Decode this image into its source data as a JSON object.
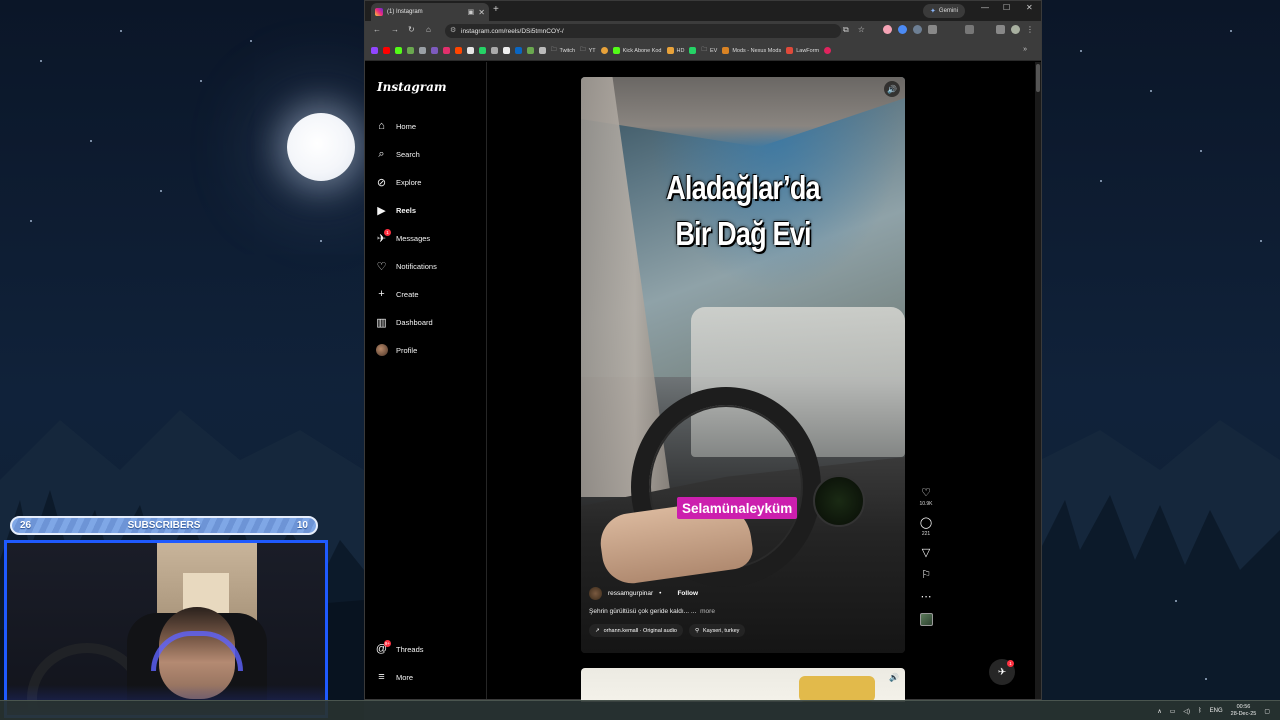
{
  "browser": {
    "tab_title": "(1) Instagram",
    "gemini_label": "Gemini",
    "url": "instagram.com/reels/DSi5tmnCOY-/",
    "bookmarks": [
      {
        "label": "Twitch",
        "color": "#9aa0a6"
      },
      {
        "label": "YT",
        "color": "#9aa0a6"
      },
      {
        "label": "Kick Abone Kod",
        "color": "#53fc18"
      },
      {
        "label": "HD",
        "color": "#e8a23a"
      },
      {
        "label": "EV",
        "color": "#9aa0a6"
      },
      {
        "label": "Mods - Nexus Mods",
        "color": "#d98324"
      },
      {
        "label": "LawForm",
        "color": "#e04a3a"
      }
    ]
  },
  "instagram": {
    "logo": "Instagram",
    "nav": [
      {
        "label": "Home",
        "icon": "home-icon",
        "glyph": "⌂"
      },
      {
        "label": "Search",
        "icon": "search-icon",
        "glyph": "⌕"
      },
      {
        "label": "Explore",
        "icon": "explore-icon",
        "glyph": "⊘"
      },
      {
        "label": "Reels",
        "icon": "reels-icon",
        "glyph": "▶"
      },
      {
        "label": "Messages",
        "icon": "messages-icon",
        "glyph": "✈",
        "badge": "1"
      },
      {
        "label": "Notifications",
        "icon": "heart-icon",
        "glyph": "♡"
      },
      {
        "label": "Create",
        "icon": "plus-icon",
        "glyph": "+"
      },
      {
        "label": "Dashboard",
        "icon": "dashboard-icon",
        "glyph": "▥"
      },
      {
        "label": "Profile",
        "icon": "avatar",
        "glyph": ""
      }
    ],
    "threads": {
      "label": "Threads",
      "badge": "9+"
    },
    "more": {
      "label": "More"
    },
    "reel": {
      "title_line1": "Aladağlar’da",
      "title_line2": "Bir Dağ Evi",
      "caption_pill": "Selamünaleyküm",
      "username": "ressamgurpinar",
      "follow": "Follow",
      "description": "Şehrin gürültüsü çok geride kaldı... ...",
      "more": "more",
      "audio": "orhann.kemall · Original audio",
      "location": "Kayseri, turkey",
      "likes": "10.9K",
      "comments": "221"
    },
    "dm_badge": "1"
  },
  "stream": {
    "sub_left": "26",
    "sub_label": "SUBSCRIBERS",
    "sub_right": "10"
  },
  "taskbar": {
    "lang": "ENG",
    "time": "00:56",
    "date": "28-Dec-25"
  }
}
